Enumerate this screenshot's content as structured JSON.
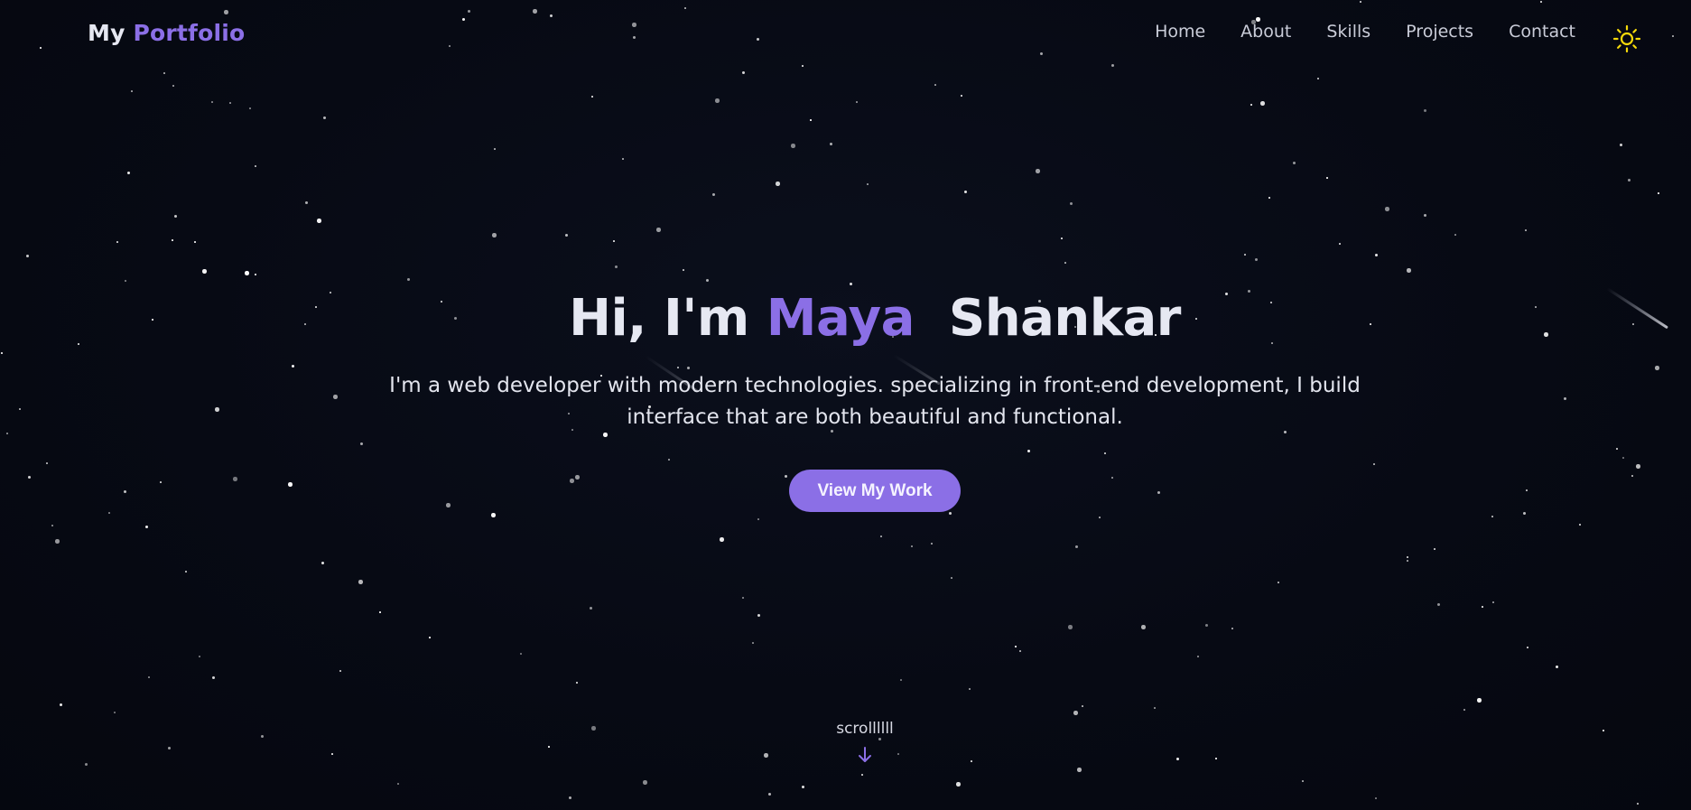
{
  "nav": {
    "brand_first": "My",
    "brand_second": "Portfolio",
    "links": [
      "Home",
      "About",
      "Skills",
      "Projects",
      "Contact"
    ],
    "theme_icon": "sun-icon"
  },
  "hero": {
    "greeting": "Hi, I'm",
    "first_name": "Maya",
    "last_name": "Shankar",
    "description_line1": "I'm a web developer with modern technologies. specializing in front-end development, I build",
    "description_line2": "interface that are both beautiful and functional.",
    "cta_label": "View My Work"
  },
  "scroll": {
    "label": "scrollllll",
    "icon": "arrow-down-icon"
  },
  "colors": {
    "accent": "#8b6fe6",
    "background": "#070a14",
    "text": "#e6e8f2",
    "sun": "#f5d90a"
  }
}
